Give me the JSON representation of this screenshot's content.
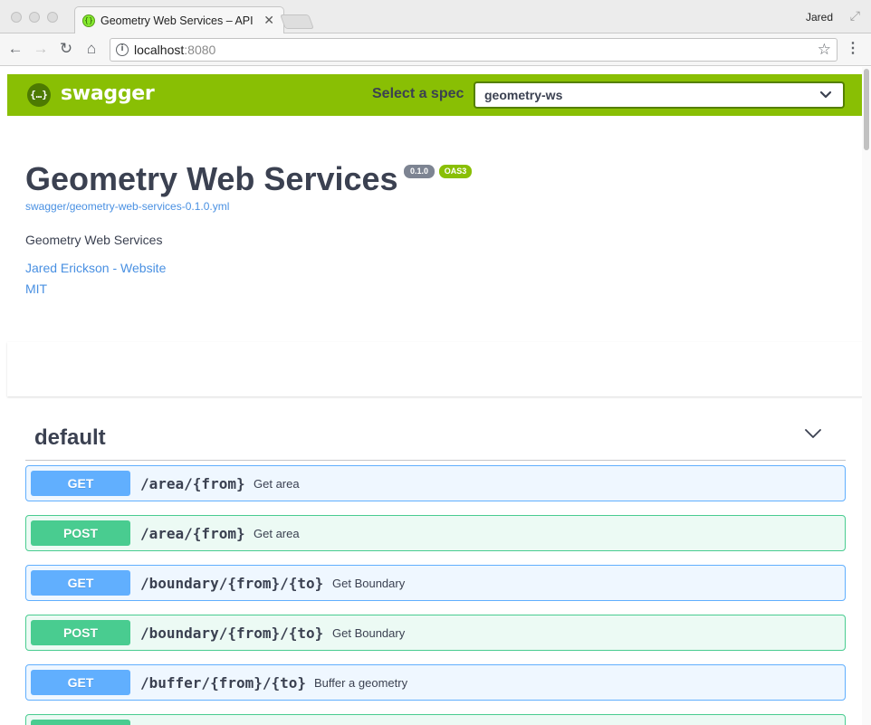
{
  "browser": {
    "tab_title": "Geometry Web Services – API",
    "profile_name": "Jared",
    "url_host": "localhost",
    "url_port": ":8080"
  },
  "swagger": {
    "logo_text": "swagger",
    "select_spec_label": "Select a spec",
    "selected_spec": "geometry-ws",
    "accent_color": "#89bf04"
  },
  "info": {
    "title": "Geometry Web Services",
    "version": "0.1.0",
    "oas_badge": "OAS3",
    "spec_url": "swagger/geometry-web-services-0.1.0.yml",
    "description": "Geometry Web Services",
    "contact_link": "Jared Erickson - Website",
    "license_link": "MIT"
  },
  "operations": {
    "tag": "default",
    "items": [
      {
        "method": "GET",
        "path": "/area/{from}",
        "summary": "Get area"
      },
      {
        "method": "POST",
        "path": "/area/{from}",
        "summary": "Get area"
      },
      {
        "method": "GET",
        "path": "/boundary/{from}/{to}",
        "summary": "Get Boundary"
      },
      {
        "method": "POST",
        "path": "/boundary/{from}/{to}",
        "summary": "Get Boundary"
      },
      {
        "method": "GET",
        "path": "/buffer/{from}/{to}",
        "summary": "Buffer a geometry"
      }
    ]
  }
}
